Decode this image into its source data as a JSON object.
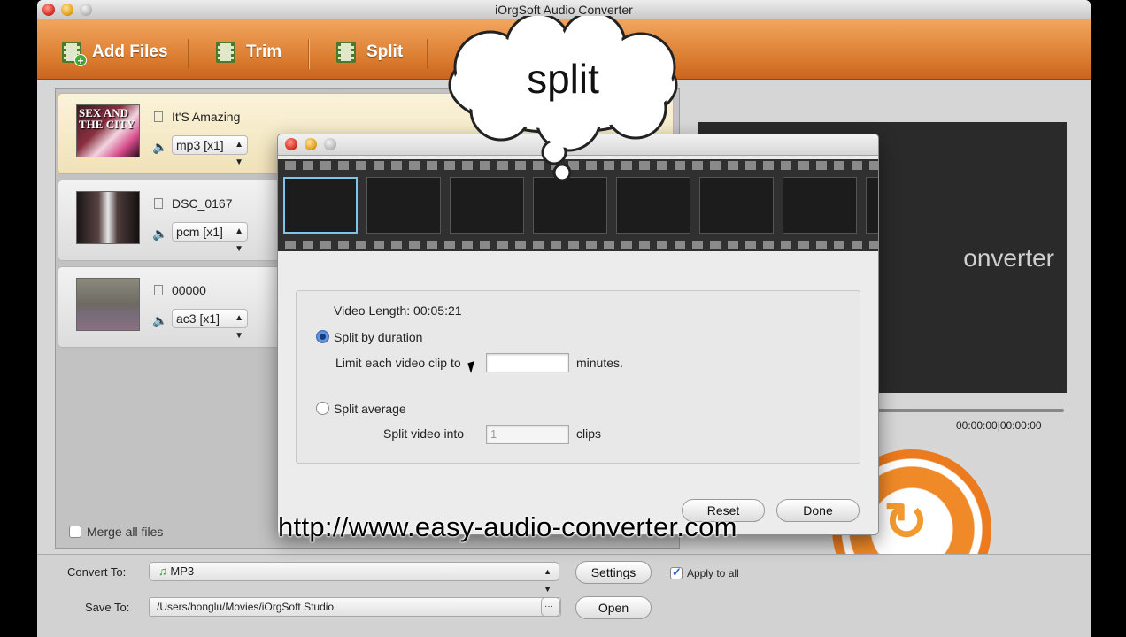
{
  "window": {
    "title": "iOrgSoft Audio Converter"
  },
  "toolbar": {
    "add_files": "Add Files",
    "trim": "Trim",
    "split": "Split"
  },
  "files": [
    {
      "name": "It'S Amazing",
      "format": "mp3 [x1]",
      "thumb_text": "SEX AND THE CITY",
      "selected": true
    },
    {
      "name": "DSC_0167",
      "format": "pcm [x1]",
      "thumb_text": "",
      "selected": false
    },
    {
      "name": "00000",
      "format": "ac3 [x1]",
      "thumb_text": "",
      "selected": false
    }
  ],
  "merge_label": "Merge all files",
  "preview": {
    "text": "onverter",
    "timecode": "00:00:00|00:00:00"
  },
  "bottom": {
    "convert_to_label": "Convert To:",
    "convert_to_value": "MP3",
    "settings_label": "Settings",
    "apply_label": "Apply to all",
    "save_to_label": "Save To:",
    "save_to_value": "/Users/honglu/Movies/iOrgSoft Studio",
    "browse_label": "···",
    "open_label": "Open"
  },
  "dialog": {
    "video_length": "Video Length: 00:05:21",
    "split_duration": "Split by duration",
    "limit_label": "Limit each video clip to",
    "limit_value": "",
    "minutes": "minutes.",
    "split_average": "Split average",
    "split_into_label": "Split video into",
    "split_into_value": "1",
    "clips": "clips",
    "reset": "Reset",
    "done": "Done"
  },
  "overlay": {
    "cloud_text": "split",
    "url": "http://www.easy-audio-converter.com"
  },
  "colors": {
    "toolbar": "#d97a2e",
    "accent_orange": "#ec7a1e",
    "selection": "#f0e2b8"
  }
}
